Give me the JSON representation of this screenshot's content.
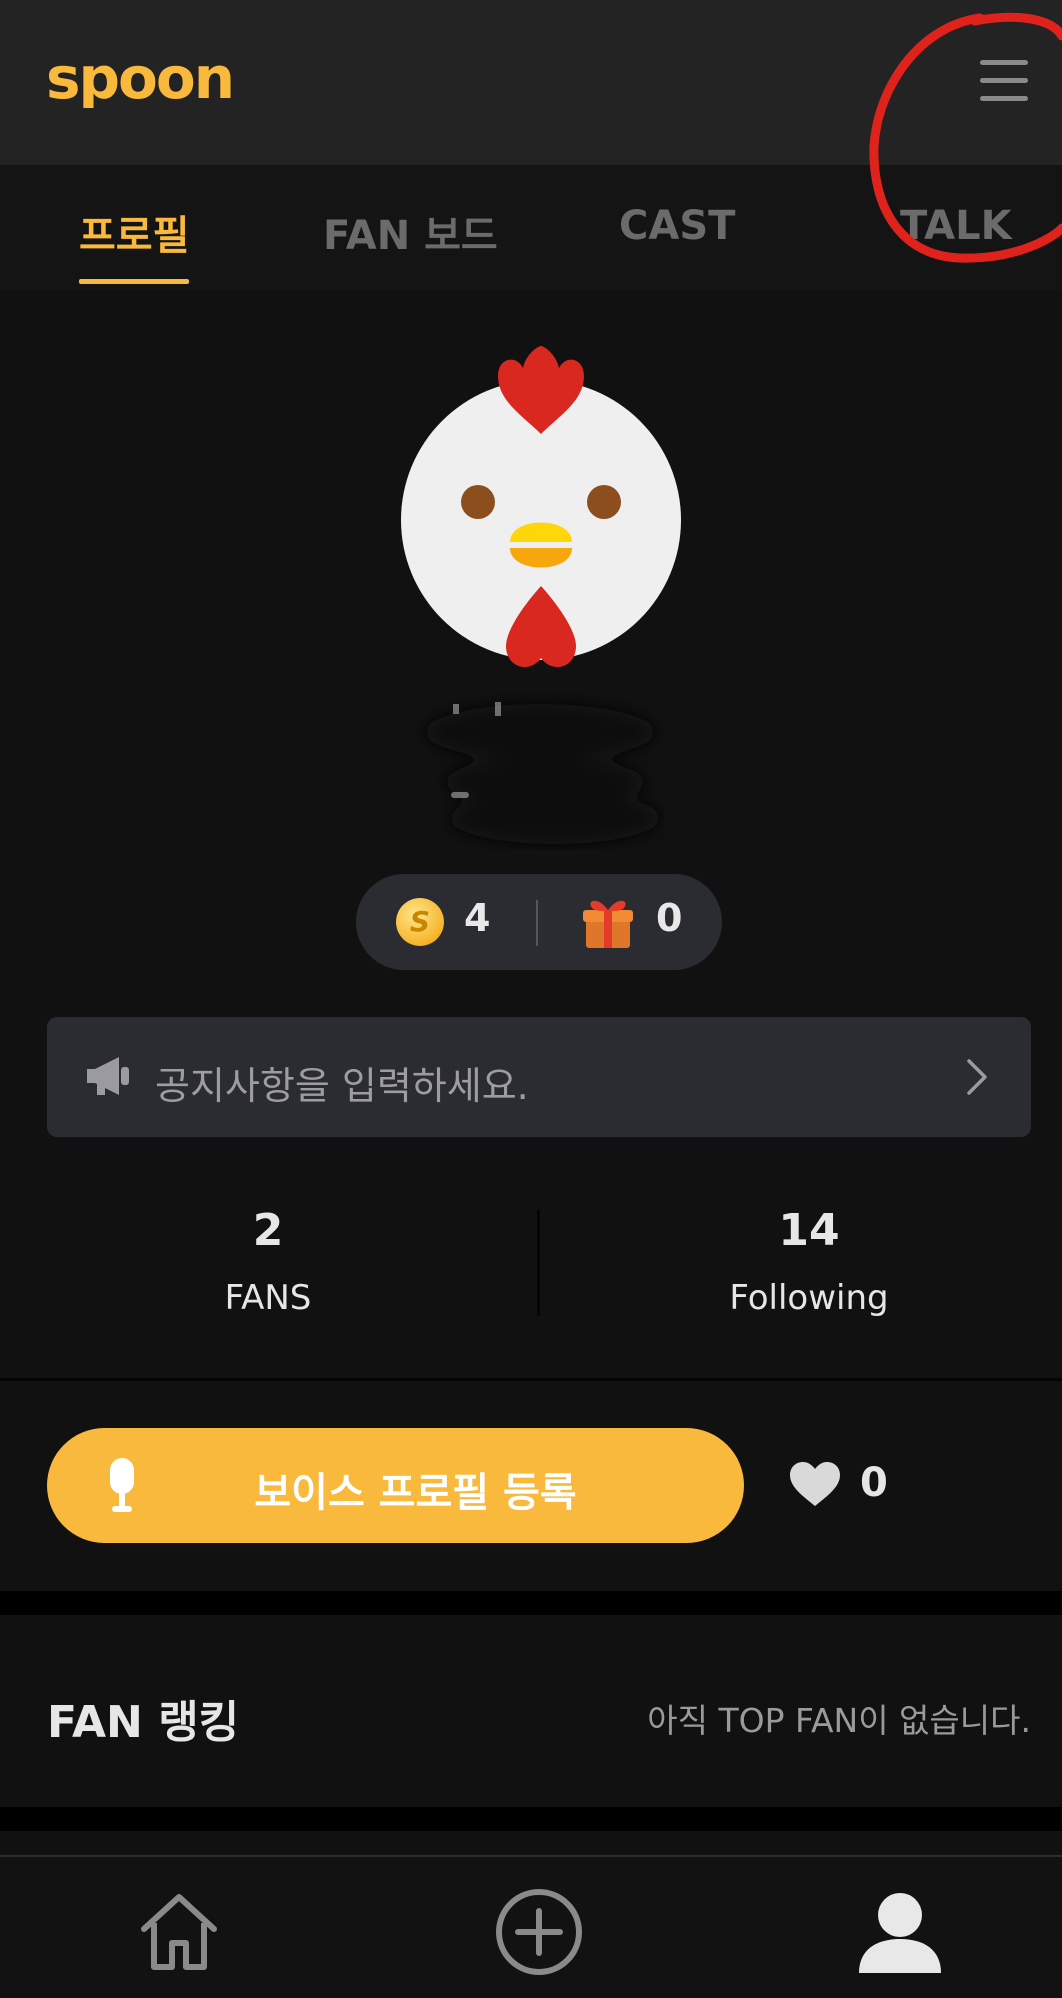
{
  "app": {
    "logo_text": "spoon",
    "brand_color": "#f9b93c"
  },
  "tabs": [
    {
      "label": "프로필",
      "active": true
    },
    {
      "label": "FAN 보드",
      "active": false
    },
    {
      "label": "CAST",
      "active": false
    },
    {
      "label": "TALK",
      "active": false
    }
  ],
  "wallet": {
    "spoon_count": "4",
    "gift_count": "0"
  },
  "notice": {
    "placeholder": "공지사항을 입력하세요."
  },
  "stats": {
    "fans_count": "2",
    "fans_label": "FANS",
    "following_count": "14",
    "following_label": "Following"
  },
  "voice_profile": {
    "button_label": "보이스 프로필 등록",
    "like_count": "0"
  },
  "fan_ranking": {
    "title": "FAN 랭킹",
    "empty_text": "아직 TOP FAN이 없습니다."
  },
  "icons": {
    "menu": "hamburger-icon",
    "coin": "spoon-coin-icon",
    "gift": "gift-icon",
    "notice": "megaphone-icon",
    "more": "chevron-right-icon",
    "mic": "mic-icon",
    "like": "heart-icon",
    "home": "home-icon",
    "create": "plus-circle-icon",
    "profile": "profile-icon"
  },
  "colors": {
    "background": "#111111",
    "header": "#232323",
    "panel": "#2b2c31",
    "annotation": "#e0221c"
  }
}
